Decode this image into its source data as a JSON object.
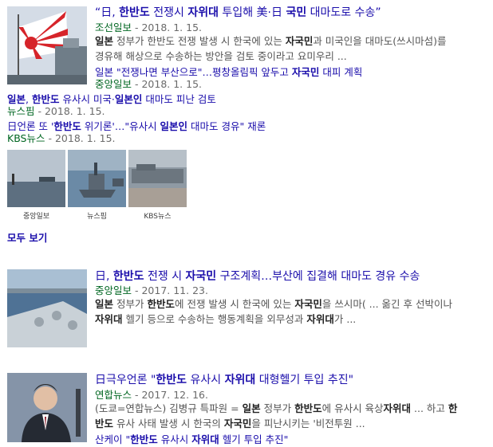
{
  "r1": {
    "title_pre": "“日, ",
    "title_b1": "한반도",
    "title_mid1": " 전쟁시 ",
    "title_b2": "자위대",
    "title_mid2": " 투입해 美·日 ",
    "title_b3": "국민",
    "title_post": " 대마도로 수송”",
    "source": "조선일보",
    "date": " - 2018. 1. 15.",
    "snip1_a": "일본",
    "snip1_b": " 정부가 한반도 전쟁 발생 시 한국에 있는 ",
    "snip1_c": "자국민",
    "snip1_d": "과 미국인을 대마도(쓰시마섬)를",
    "snip2": "경유해 해상으로 수송하는 방안을 검토 중이라고 요미우리 ...",
    "sub1": {
      "t1": "일본 \"전쟁나면 부산으로\"…평창올림픽 앞두고 ",
      "b1": "자국민",
      "t2": " 대피 계획",
      "source": "중앙일보",
      "date": " - 2018. 1. 15."
    },
    "sub2": {
      "b1": "일본",
      "t1": ", ",
      "b2": "한반도",
      "t2": " 유사시 미국·",
      "b3": "일본인",
      "t3": " 대마도 피난 검토",
      "source": "뉴스핌",
      "date": " - 2018. 1. 15."
    },
    "sub3": {
      "t1": "日언론 또 '",
      "b1": "한반도",
      "t2": " 위기론'…\"유사시 ",
      "b2": "일본인",
      "t3": " 대마도 경유\" 재론",
      "source": "KBS뉴스",
      "date": " - 2018. 1. 15."
    },
    "captions": [
      "중앙일보",
      "뉴스핌",
      "KBS뉴스"
    ],
    "more": "모두 보기"
  },
  "r2": {
    "t1": "日, ",
    "b1": "한반도",
    "t2": " 전쟁 시 ",
    "b2": "자국민",
    "t3": " 구조계획…부산에 집결해 대마도 경유 수송",
    "source": "중앙일보",
    "date": " - 2017. 11. 23.",
    "s1_a": "일본",
    "s1_b": " 정부가 ",
    "s1_c": "한반도",
    "s1_d": "에 전쟁 발생 시 한국에 있는 ",
    "s1_e": "자국민",
    "s1_f": "을 쓰시마( ... 옮긴 후 선박이나",
    "s2_a": "자위대",
    "s2_b": " 헬기 등으로 수송하는 행동계획을 외무성과 ",
    "s2_c": "자위대",
    "s2_d": "가 ..."
  },
  "r3": {
    "t1": "日극우언론 \"",
    "b1": "한반도",
    "t2": " 유사시 ",
    "b2": "자위대",
    "t3": " 대형헬기 투입 추진\"",
    "source": "연합뉴스",
    "date": " - 2017. 12. 16.",
    "s1_a": "(도쿄=연합뉴스) 김병규 특파원 = ",
    "s1_b": "일본",
    "s1_c": " 정부가 ",
    "s1_d": "한반도",
    "s1_e": "에 유사시 육상",
    "s1_f": "자위대",
    "s1_g": " ... 하고 ",
    "s1_h": "한",
    "s2_a": "반도",
    "s2_b": " 유사 사태 발생 시 한국의 ",
    "s2_c": "자국민",
    "s2_d": "을 피난시키는 '비전투원 ...",
    "sub": {
      "t1": "산케이 \"",
      "b1": "한반도",
      "t2": " 유사시 ",
      "b2": "자위대",
      "t3": " 헬기 투입 추진\""
    }
  },
  "colors": {
    "link": "#1a0dab",
    "source": "#006621",
    "snippet": "#545454"
  }
}
